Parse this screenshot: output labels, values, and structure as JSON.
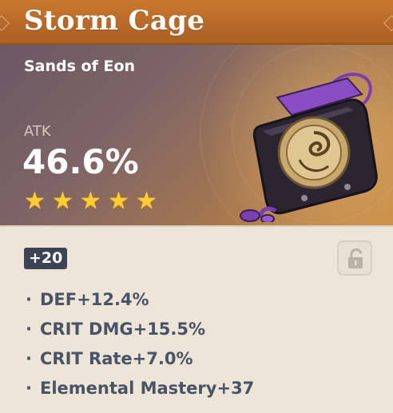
{
  "artifact": {
    "name": "Storm Cage",
    "type": "Sands of Eon",
    "main_stat": {
      "name": "ATK",
      "value": "46.6%"
    },
    "rarity_stars": 5,
    "level": "+20",
    "substats": [
      {
        "bullet": "·",
        "text": "DEF+12.4%"
      },
      {
        "bullet": "·",
        "text": "CRIT DMG+15.5%"
      },
      {
        "bullet": "·",
        "text": "CRIT Rate+7.0%"
      },
      {
        "bullet": "·",
        "text": "Elemental Mastery+37"
      }
    ]
  },
  "icons": {
    "lock": "unlock-icon",
    "star": "star-icon"
  },
  "colors": {
    "title_bar": "#b8682a",
    "star": "#ffcc32",
    "body": "#ece5d8",
    "level_badge": "#3b4354",
    "substat_text": "#4a5366"
  }
}
